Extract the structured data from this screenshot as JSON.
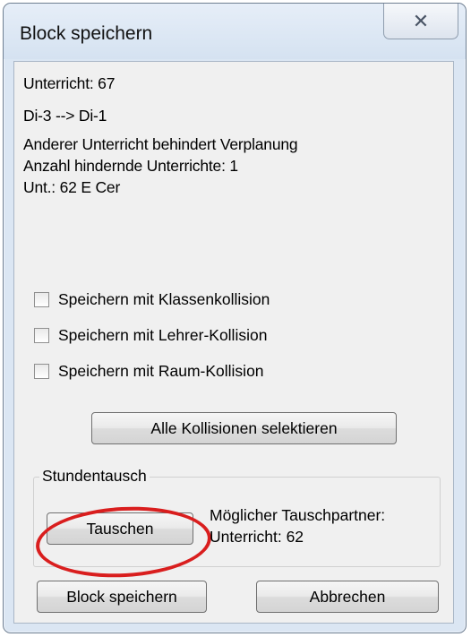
{
  "dialog": {
    "title": "Block speichern",
    "close_glyph": "✕",
    "info_lines": [
      "Unterricht: 67",
      "Di-3 --> Di-1",
      "Anderer Unterricht behindert Verplanung",
      "Anzahl hindernde Unterrichte: 1",
      "Unt.: 62 E Cer"
    ],
    "checkboxes": [
      {
        "label": "Speichern mit Klassenkollision",
        "checked": false
      },
      {
        "label": "Speichern mit Lehrer-Kollision",
        "checked": false
      },
      {
        "label": "Speichern mit Raum-Kollision",
        "checked": false
      }
    ],
    "select_all_label": "Alle Kollisionen selektieren",
    "swap_group": {
      "title": "Stundentausch",
      "swap_button_label": "Tauschen",
      "partner_label": "Möglicher Tauschpartner:",
      "partner_value": "Unterricht: 62"
    },
    "save_block_label": "Block speichern",
    "cancel_label": "Abbrechen"
  },
  "colors": {
    "window_frame": "#dbe6f3",
    "client_bg": "#f0f0f0",
    "highlight": "#d91e1e"
  }
}
